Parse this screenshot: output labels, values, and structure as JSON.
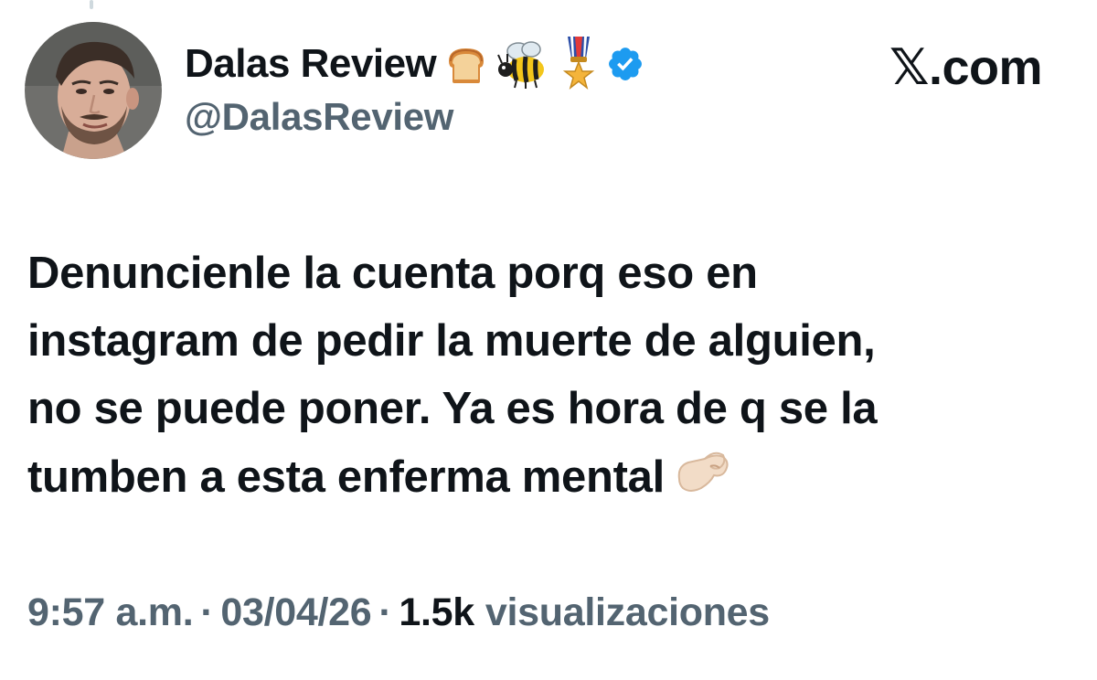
{
  "author": {
    "display_name": "Dalas Review",
    "handle": "@DalasReview",
    "name_emojis": [
      "bread-icon",
      "bee-icon",
      "military-medal-icon"
    ],
    "verified": true,
    "verified_badge_color": "#1d9bf0"
  },
  "site": {
    "label": "𝕏.com"
  },
  "tweet": {
    "lines": [
      "Denuncienle la cuenta porq eso en",
      "instagram de pedir la muerte de alguien,",
      "no se puede poner. Ya es hora de q se la",
      "tumben a esta enferma mental"
    ],
    "trailing_emoji": "pinching-hand-icon"
  },
  "meta": {
    "time": "9:57 a.m.",
    "separator": "·",
    "date": "03/04/26",
    "views_count": "1.5k",
    "views_label": "visualizaciones"
  },
  "colors": {
    "text_primary": "#0f1419",
    "text_secondary": "#536471",
    "background": "#ffffff"
  }
}
